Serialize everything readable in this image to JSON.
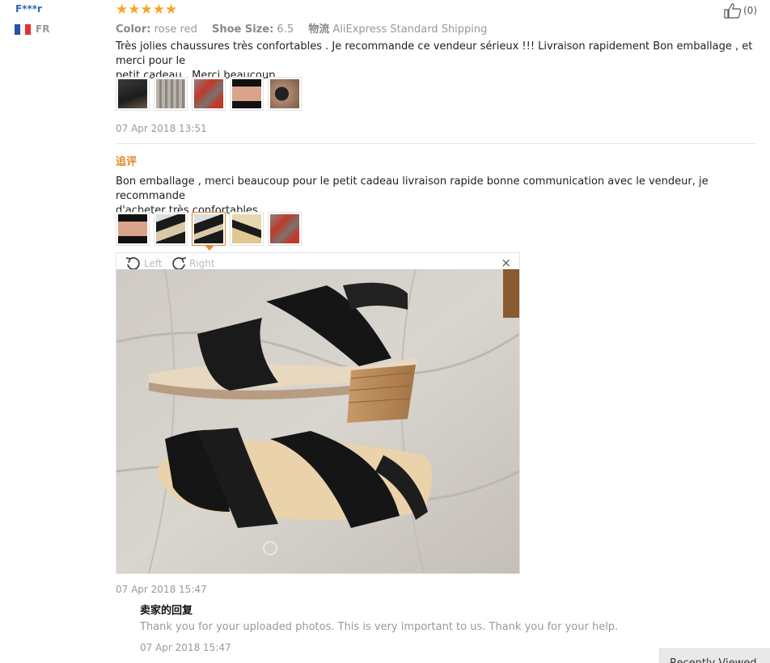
{
  "review1": {
    "user": "F***r",
    "country": "FR",
    "stars": "★★★★★",
    "color_label": "Color:",
    "color_value": "rose red",
    "size_label": "Shoe Size:",
    "size_value": "6.5",
    "ship_label": "物流",
    "ship_value": "AliExpress Standard Shipping",
    "like_count": "(0)",
    "text_line1": "Très jolies chaussures très confortables . Je recommande ce vendeur sérieux !!! Livraison rapidement Bon emballage , et merci pour le",
    "text_line2": "petit cadeau . Merci beaucoup",
    "date": "07 Apr 2018 13:51"
  },
  "review2": {
    "followup_label": "追评",
    "text_line1": "Bon emballage , merci beaucoup pour le petit cadeau livraison rapide bonne communication avec le vendeur, je recommande",
    "text_line2": "d'acheter très confortables",
    "date": "07 Apr 2018 15:47"
  },
  "viewer": {
    "rotate_left": "Left",
    "rotate_right": "Right",
    "close": "×"
  },
  "seller_reply": {
    "title": "卖家的回复",
    "text": "Thank you for your uploaded photos. This is very important to us. Thank you for your help.",
    "date": "07 Apr 2018 15:47"
  },
  "recently_viewed": "Recently Viewed",
  "colors": {
    "star": "#f5a623",
    "user": "#2a6ab8",
    "accent": "#e08a2c"
  }
}
